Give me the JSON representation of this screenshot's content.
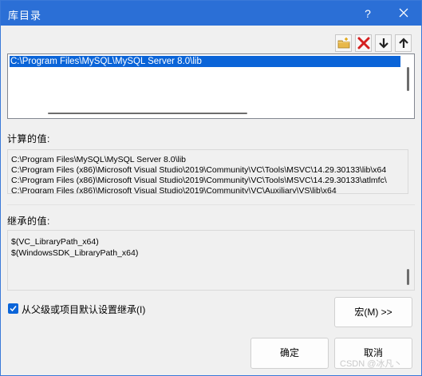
{
  "window": {
    "title": "库目录",
    "help_label": "?"
  },
  "toolbar": {
    "buttons": [
      {
        "icon": "new-folder-icon"
      },
      {
        "icon": "delete-icon"
      },
      {
        "icon": "move-down-icon"
      },
      {
        "icon": "move-up-icon"
      }
    ]
  },
  "path_list": {
    "items": [
      "C:\\Program Files\\MySQL\\MySQL Server 8.0\\lib"
    ],
    "selected_index": 0
  },
  "evaluated": {
    "label": "计算的值:",
    "lines": [
      "C:\\Program Files\\MySQL\\MySQL Server 8.0\\lib",
      "C:\\Program Files (x86)\\Microsoft Visual Studio\\2019\\Community\\VC\\Tools\\MSVC\\14.29.30133\\lib\\x64",
      "C:\\Program Files (x86)\\Microsoft Visual Studio\\2019\\Community\\VC\\Tools\\MSVC\\14.29.30133\\atlmfc\\",
      "C:\\Program Files (x86)\\Microsoft Visual Studio\\2019\\Community\\VC\\Auxiliary\\VS\\lib\\x64"
    ]
  },
  "inherited": {
    "label": "继承的值:",
    "lines": [
      "$(VC_LibraryPath_x64)",
      "$(WindowsSDK_LibraryPath_x64)"
    ]
  },
  "inherit_checkbox": {
    "label": "从父级或项目默认设置继承(I)",
    "checked": true
  },
  "buttons": {
    "macro": "宏(M) >>",
    "ok": "确定",
    "cancel": "取消"
  },
  "watermark": "CSDN @冰凡丶",
  "colors": {
    "titlebar": "#2b6fd6",
    "selection": "#0a64d8",
    "dialog_bg": "#f0f0f0"
  }
}
